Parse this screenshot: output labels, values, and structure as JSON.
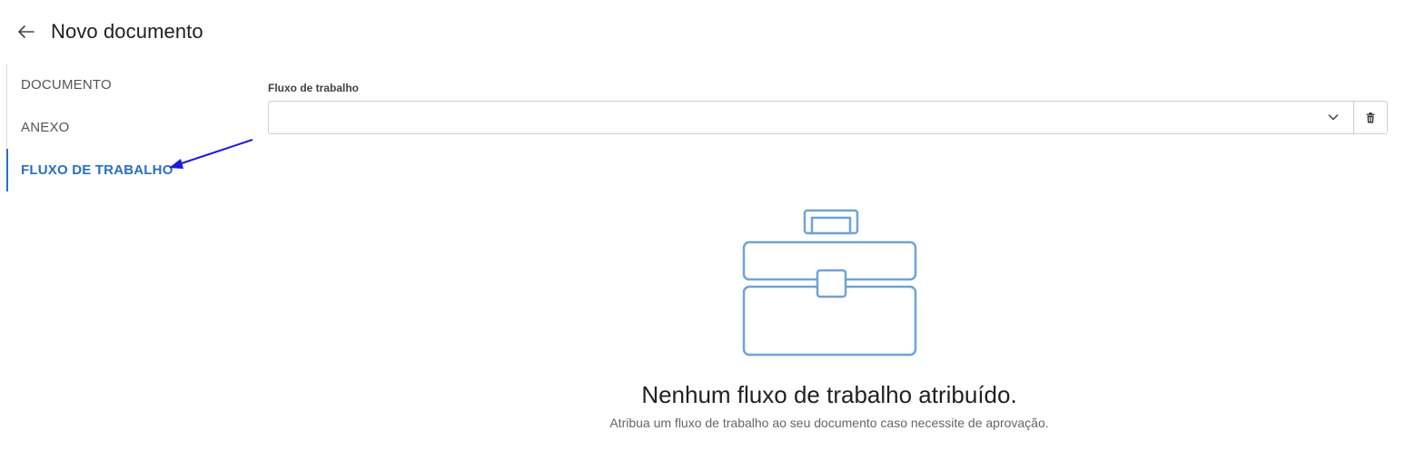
{
  "header": {
    "back_icon": "arrow-left-icon",
    "title": "Novo documento"
  },
  "sidenav": {
    "items": [
      {
        "label": "DOCUMENTO",
        "active": false
      },
      {
        "label": "ANEXO",
        "active": false
      },
      {
        "label": "FLUXO DE TRABALHO",
        "active": true
      }
    ]
  },
  "workflow_field": {
    "label": "Fluxo de trabalho",
    "value": "",
    "dropdown_icon": "chevron-down-icon",
    "delete_icon": "trash-icon"
  },
  "empty_state": {
    "icon": "toolbox-icon",
    "title": "Nenhum fluxo de trabalho atribuído.",
    "subtitle": "Atribua um fluxo de trabalho ao seu documento caso necessite de aprovação."
  },
  "colors": {
    "accent": "#2a6fbf",
    "annotation_arrow": "#1a1adb",
    "illustration": "#6fa3d8"
  }
}
